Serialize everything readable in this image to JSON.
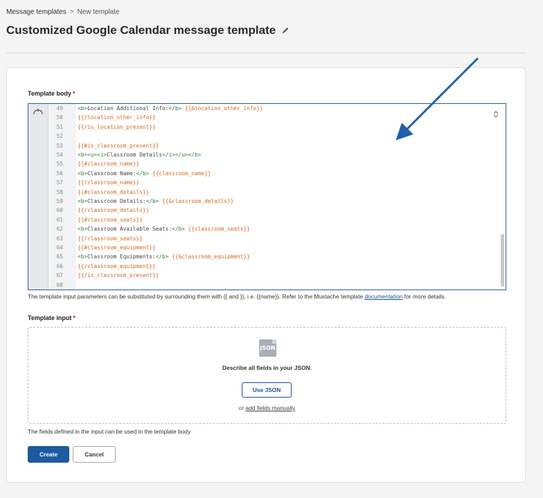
{
  "breadcrumb": {
    "parent": "Message templates",
    "separator": ">",
    "current": "New template"
  },
  "page": {
    "title": "Customized Google Calendar message template"
  },
  "template_body": {
    "label": "Template body",
    "required_mark": "*",
    "lines": [
      {
        "no": "49",
        "parts": [
          [
            "tag",
            "<b>"
          ],
          [
            "txt",
            "Location Additional Info:"
          ],
          [
            "tag",
            "</b>"
          ],
          [
            "txt",
            " "
          ],
          [
            "mus",
            "{{&location_other_info}}"
          ]
        ]
      },
      {
        "no": "50",
        "parts": [
          [
            "mus",
            "{{/location_other_info}}"
          ]
        ]
      },
      {
        "no": "51",
        "parts": [
          [
            "mus",
            "{{/is_location_present}}"
          ]
        ]
      },
      {
        "no": "52",
        "parts": []
      },
      {
        "no": "53",
        "parts": [
          [
            "mus",
            "{{#is_classroom_present}}"
          ]
        ]
      },
      {
        "no": "54",
        "parts": [
          [
            "tag",
            "<b><u><i>"
          ],
          [
            "txt",
            "Classroom Details"
          ],
          [
            "tag",
            "</i></u></b>"
          ]
        ]
      },
      {
        "no": "55",
        "parts": [
          [
            "mus",
            "{{#classroom_name}}"
          ]
        ]
      },
      {
        "no": "56",
        "parts": [
          [
            "tag",
            "<b>"
          ],
          [
            "txt",
            "Classroom Name:"
          ],
          [
            "tag",
            "</b>"
          ],
          [
            "txt",
            " "
          ],
          [
            "mus",
            "{{classroom_name}}"
          ]
        ]
      },
      {
        "no": "57",
        "parts": [
          [
            "mus",
            "{{/classroom_name}}"
          ]
        ]
      },
      {
        "no": "58",
        "parts": [
          [
            "mus",
            "{{#classroom_details}}"
          ]
        ]
      },
      {
        "no": "59",
        "parts": [
          [
            "tag",
            "<b>"
          ],
          [
            "txt",
            "Classroom Details:"
          ],
          [
            "tag",
            "</b>"
          ],
          [
            "txt",
            " "
          ],
          [
            "mus",
            "{{&classroom_details}}"
          ]
        ]
      },
      {
        "no": "60",
        "parts": [
          [
            "mus",
            "{{/classroom_details}}"
          ]
        ]
      },
      {
        "no": "61",
        "parts": [
          [
            "mus",
            "{{#classroom_seats}}"
          ]
        ]
      },
      {
        "no": "62",
        "parts": [
          [
            "tag",
            "<b>"
          ],
          [
            "txt",
            "Classroom Available Seats:"
          ],
          [
            "tag",
            "</b>"
          ],
          [
            "txt",
            " "
          ],
          [
            "mus",
            "{{classroom_seats}}"
          ]
        ]
      },
      {
        "no": "63",
        "parts": [
          [
            "mus",
            "{{/classroom_seats}}"
          ]
        ]
      },
      {
        "no": "64",
        "parts": [
          [
            "mus",
            "{{#classroom_equipment}}"
          ]
        ]
      },
      {
        "no": "65",
        "parts": [
          [
            "tag",
            "<b>"
          ],
          [
            "txt",
            "Classroom Equipments:"
          ],
          [
            "tag",
            "</b>"
          ],
          [
            "txt",
            " "
          ],
          [
            "mus",
            "{{&classroom_equipment}}"
          ]
        ]
      },
      {
        "no": "66",
        "parts": [
          [
            "mus",
            "{{/classroom_equipment}}"
          ]
        ]
      },
      {
        "no": "67",
        "parts": [
          [
            "mus",
            "{{/is_classroom_present}}"
          ]
        ]
      },
      {
        "no": "68",
        "parts": []
      }
    ],
    "help_prefix": "The template input parameters can be substituted by surrounding them with {{ and }}, i.e. {{name}}. Refer to the Mustache template ",
    "help_link": "documentation",
    "help_suffix": " for more details."
  },
  "template_input": {
    "label": "Template input",
    "required_mark": "*",
    "icon_text": "JSON",
    "title": "Describe all fields in your JSON.",
    "use_json_label": "Use JSON",
    "alt_prefix": "or ",
    "alt_link": "add fields manually",
    "help": "The fields defined in the input can be used in the template body"
  },
  "actions": {
    "create_label": "Create",
    "cancel_label": "Cancel"
  },
  "colors": {
    "primary": "#1d5ba0",
    "tag": "#2e7d32",
    "mustache": "#d2691e",
    "annotation_arrow": "#1f5fad"
  },
  "icons": {
    "edit": "pencil-icon",
    "fold": "fold-icon",
    "json": "json-file-icon",
    "scroll": "scroll-updown-icon"
  }
}
